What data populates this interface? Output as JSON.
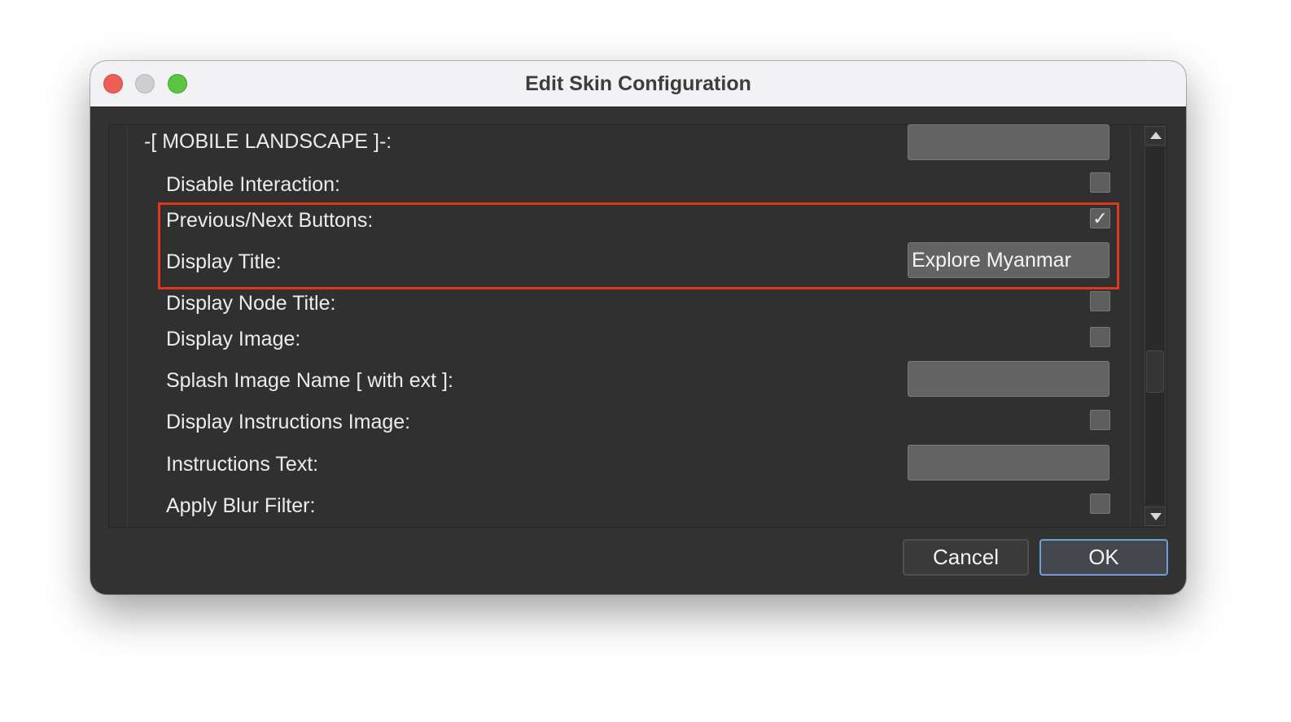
{
  "window": {
    "title": "Edit Skin Configuration"
  },
  "form": {
    "section_header": "-[ MOBILE LANDSCAPE ]-:",
    "section_field_value": "",
    "rows": [
      {
        "label": "Disable Interaction:",
        "control": "checkbox",
        "checked": false
      },
      {
        "label": "Previous/Next Buttons:",
        "control": "checkbox",
        "checked": true,
        "check_glyph": "✓"
      },
      {
        "label": "Display Title:",
        "control": "text",
        "value": "Explore Myanmar"
      },
      {
        "label": "Display Node Title:",
        "control": "checkbox",
        "checked": false
      },
      {
        "label": "Display Image:",
        "control": "checkbox",
        "checked": false
      },
      {
        "label": "Splash Image Name [ with ext ]:",
        "control": "text",
        "value": ""
      },
      {
        "label": "Display Instructions Image:",
        "control": "checkbox",
        "checked": false
      },
      {
        "label": "Instructions Text:",
        "control": "text",
        "value": ""
      },
      {
        "label": "Apply Blur Filter:",
        "control": "checkbox",
        "checked": false
      }
    ]
  },
  "highlight": {
    "color": "#e2361d",
    "covers": [
      "Previous/Next Buttons:",
      "Display Title:"
    ]
  },
  "buttons": {
    "cancel_label": "Cancel",
    "ok_label": "OK"
  },
  "colors": {
    "window_bg": "#323232",
    "titlebar_bg": "#f2f1f3",
    "ok_border": "#6e9fd9",
    "close_light": "#ec5f57",
    "minimize_light": "#cfcdd0",
    "zoom_light": "#5bc443"
  }
}
